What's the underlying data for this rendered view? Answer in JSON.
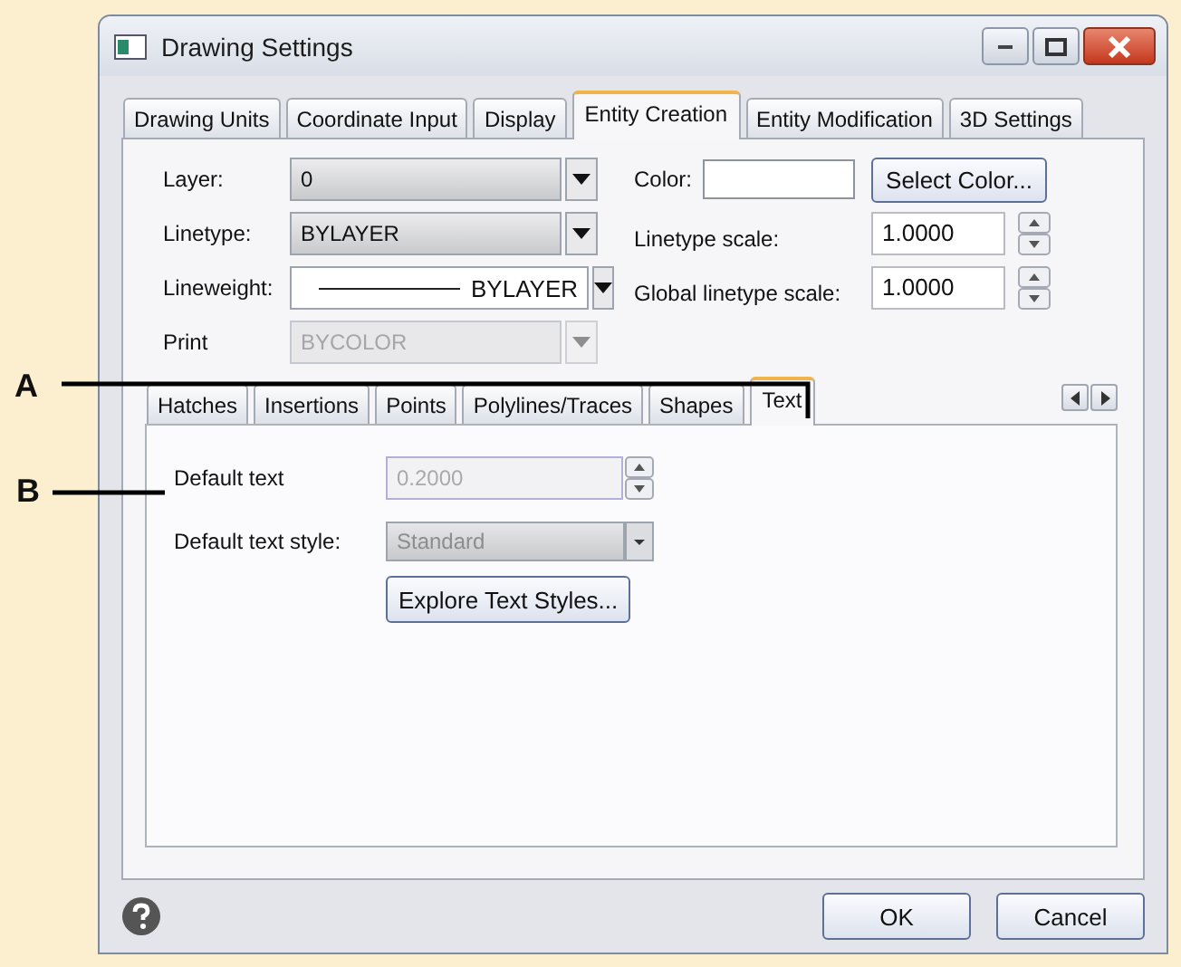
{
  "window": {
    "title": "Drawing Settings"
  },
  "tabs": [
    {
      "label": "Drawing Units",
      "selected": false
    },
    {
      "label": "Coordinate Input",
      "selected": false
    },
    {
      "label": "Display",
      "selected": false
    },
    {
      "label": "Entity Creation",
      "selected": true
    },
    {
      "label": "Entity Modification",
      "selected": false
    },
    {
      "label": "3D Settings",
      "selected": false
    }
  ],
  "fields": [
    {
      "kind": "dropdown",
      "label": "Layer:",
      "value": "0",
      "disabled": false
    },
    {
      "kind": "dropdown",
      "label": "Linetype:",
      "value": "BYLAYER",
      "disabled": false
    },
    {
      "kind": "lineweight",
      "label": "Lineweight:",
      "value": "BYLAYER",
      "disabled": false
    },
    {
      "kind": "dropdown",
      "label": "Print",
      "value": "BYCOLOR",
      "disabled": true
    }
  ],
  "right_fields": [
    {
      "kind": "color",
      "label": "Color:",
      "button": "Select Color..."
    },
    {
      "kind": "spinner",
      "label": "Linetype scale:",
      "value": "1.0000"
    },
    {
      "kind": "spinner",
      "label": "Global linetype scale:",
      "value": "1.0000"
    }
  ],
  "subtabs": [
    {
      "label": "Hatches",
      "selected": false
    },
    {
      "label": "Insertions",
      "selected": false
    },
    {
      "label": "Points",
      "selected": false
    },
    {
      "label": "Polylines/Traces",
      "selected": false
    },
    {
      "label": "Shapes",
      "selected": false
    },
    {
      "label": "Text",
      "selected": true
    }
  ],
  "text_panel": {
    "default_text": {
      "label": "Default text",
      "value": "0.2000",
      "disabled": true
    },
    "text_style": {
      "label": "Default text style:",
      "value": "Standard",
      "disabled": true
    },
    "explore_button": "Explore Text Styles..."
  },
  "footer_buttons": [
    "OK",
    "Cancel"
  ],
  "callouts": [
    {
      "label": "A"
    },
    {
      "label": "B"
    }
  ]
}
